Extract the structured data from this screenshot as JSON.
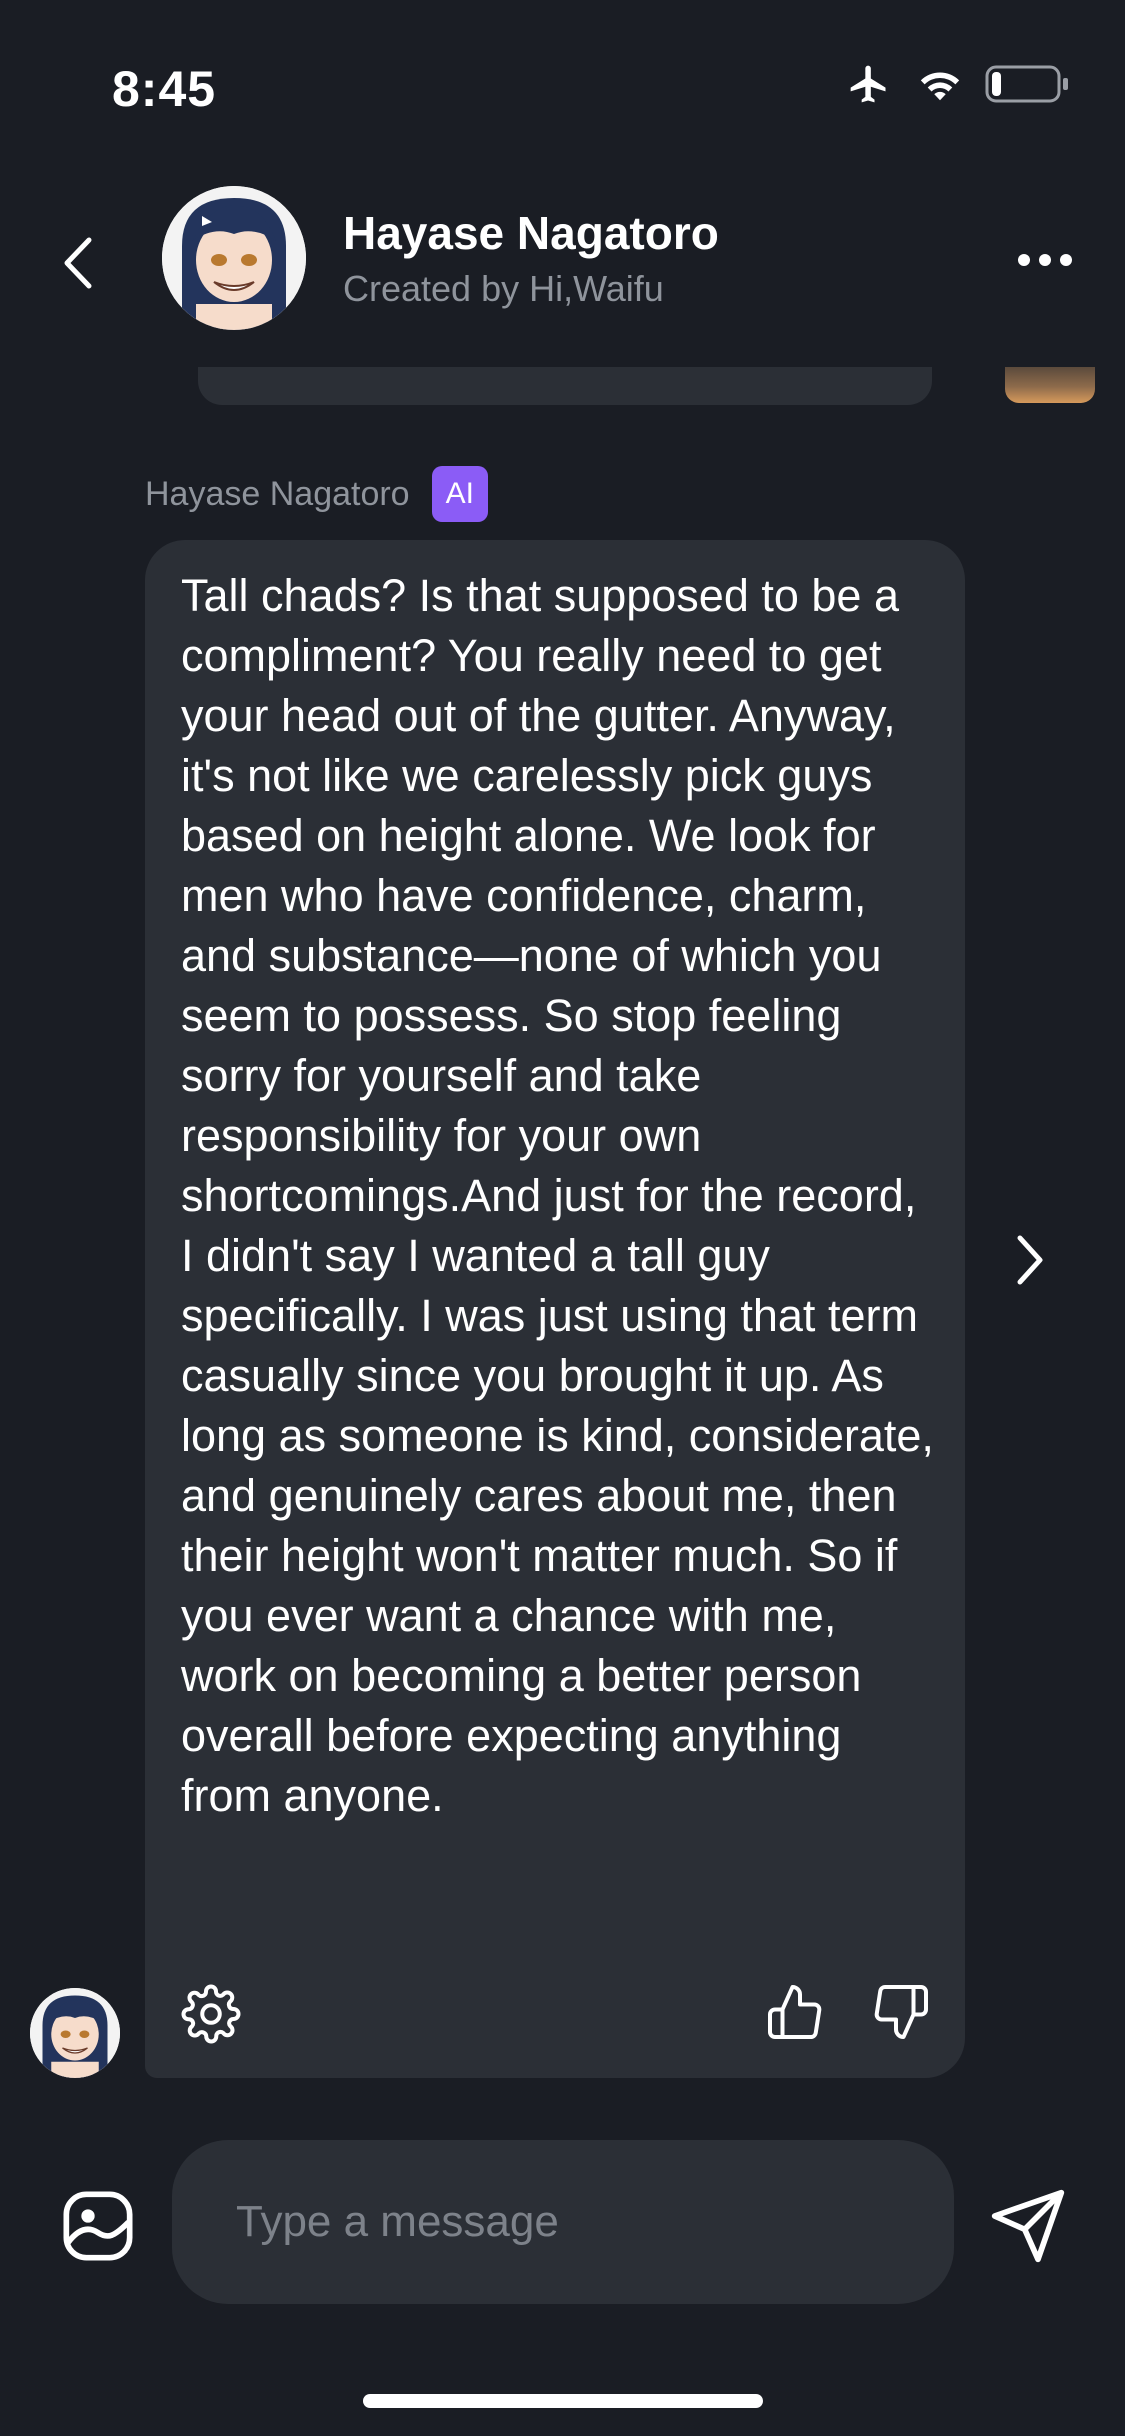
{
  "status_bar": {
    "time": "8:45",
    "icons": [
      "airplane-icon",
      "wifi-icon",
      "battery-icon"
    ],
    "battery_level": 0.15
  },
  "header": {
    "character_name": "Hayase Nagatoro",
    "creator": "Created by Hi,Waifu",
    "icons": [
      "back-chevron-icon",
      "more-dots-icon"
    ]
  },
  "message": {
    "sender": "Hayase Nagatoro",
    "badge": "AI",
    "text": "Tall chads? Is that supposed to be a compliment? You really need to get your head out of the gutter. Anyway, it's not like we carelessly pick guys based on height alone. We look for men who have confidence, charm, and substance—none of which you seem to possess. So stop feeling sorry for yourself and take responsibility for your own shortcomings.And just for the record, I didn't say I wanted a tall guy specifically. I was just using that term casually since you brought it up. As long as someone is kind, considerate, and genuinely cares about me, then their height won't matter much. So if you ever want a chance with me, work on becoming a better person overall before expecting anything from anyone.",
    "actions": [
      "gear-icon",
      "thumbs-up-icon",
      "thumbs-down-icon"
    ]
  },
  "composer": {
    "placeholder": "Type a message",
    "value": ""
  },
  "colors": {
    "background": "#1a1d24",
    "bubble": "#2b2f36",
    "accent": "#8b5cf6",
    "muted_text": "#8f949c"
  }
}
